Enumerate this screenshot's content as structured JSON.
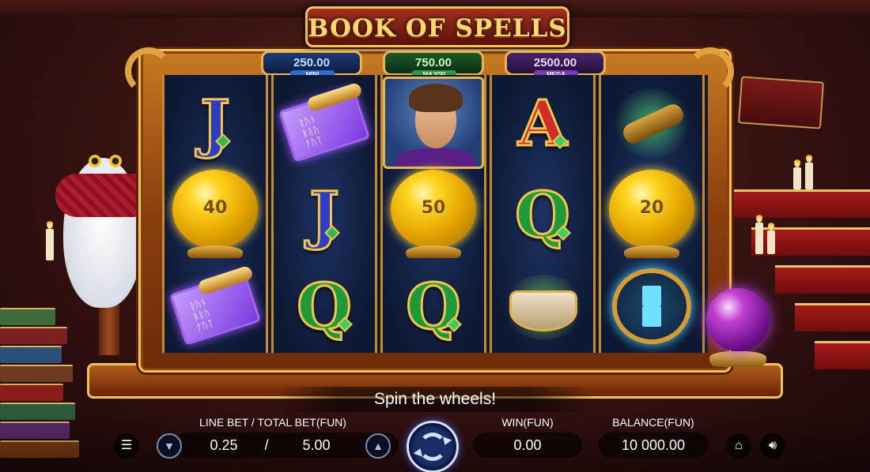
{
  "game": {
    "title": "BOOK OF SPELLS"
  },
  "jackpots": [
    {
      "value": "250.00",
      "label": "MINI"
    },
    {
      "value": "750.00",
      "label": "MAJOR"
    },
    {
      "value": "2500.00",
      "label": "MEGA"
    }
  ],
  "reels": [
    [
      {
        "type": "letter",
        "letter": "J"
      },
      {
        "type": "orb",
        "value": "40"
      },
      {
        "type": "scroll",
        "runes": [
          "ᚱᚢᚾ",
          "ᛒᚱᚢ",
          "ᚨᚢᛏ"
        ]
      }
    ],
    [
      {
        "type": "scroll",
        "runes": [
          "ᚱᚢᚾ",
          "ᛒᚱᚢ",
          "ᚨᚢᛏ"
        ]
      },
      {
        "type": "letter",
        "letter": "J"
      },
      {
        "type": "letter",
        "letter": "Q"
      }
    ],
    [
      {
        "type": "portrait"
      },
      {
        "type": "orb",
        "value": "50"
      },
      {
        "type": "letter",
        "letter": "Q"
      }
    ],
    [
      {
        "type": "letter",
        "letter": "A"
      },
      {
        "type": "letter",
        "letter": "Q"
      },
      {
        "type": "bowl"
      }
    ],
    [
      {
        "type": "relic"
      },
      {
        "type": "orb",
        "value": "20"
      },
      {
        "type": "hourglass"
      }
    ]
  ],
  "message": "Spin the wheels!",
  "controls": {
    "bet_label": "LINE BET / TOTAL BET(FUN)",
    "line_bet": "0.25",
    "separator": "/",
    "total_bet": "5.00",
    "win_label": "WIN(FUN)",
    "win": "0.00",
    "balance_label": "BALANCE(FUN)",
    "balance": "10 000.00",
    "bet_down_icon": "chevron-down",
    "bet_up_icon": "chevron-up",
    "menu_icon": "hamburger",
    "home_icon": "home",
    "sound_icon": "speaker",
    "spin_icon": "refresh-arrows"
  }
}
